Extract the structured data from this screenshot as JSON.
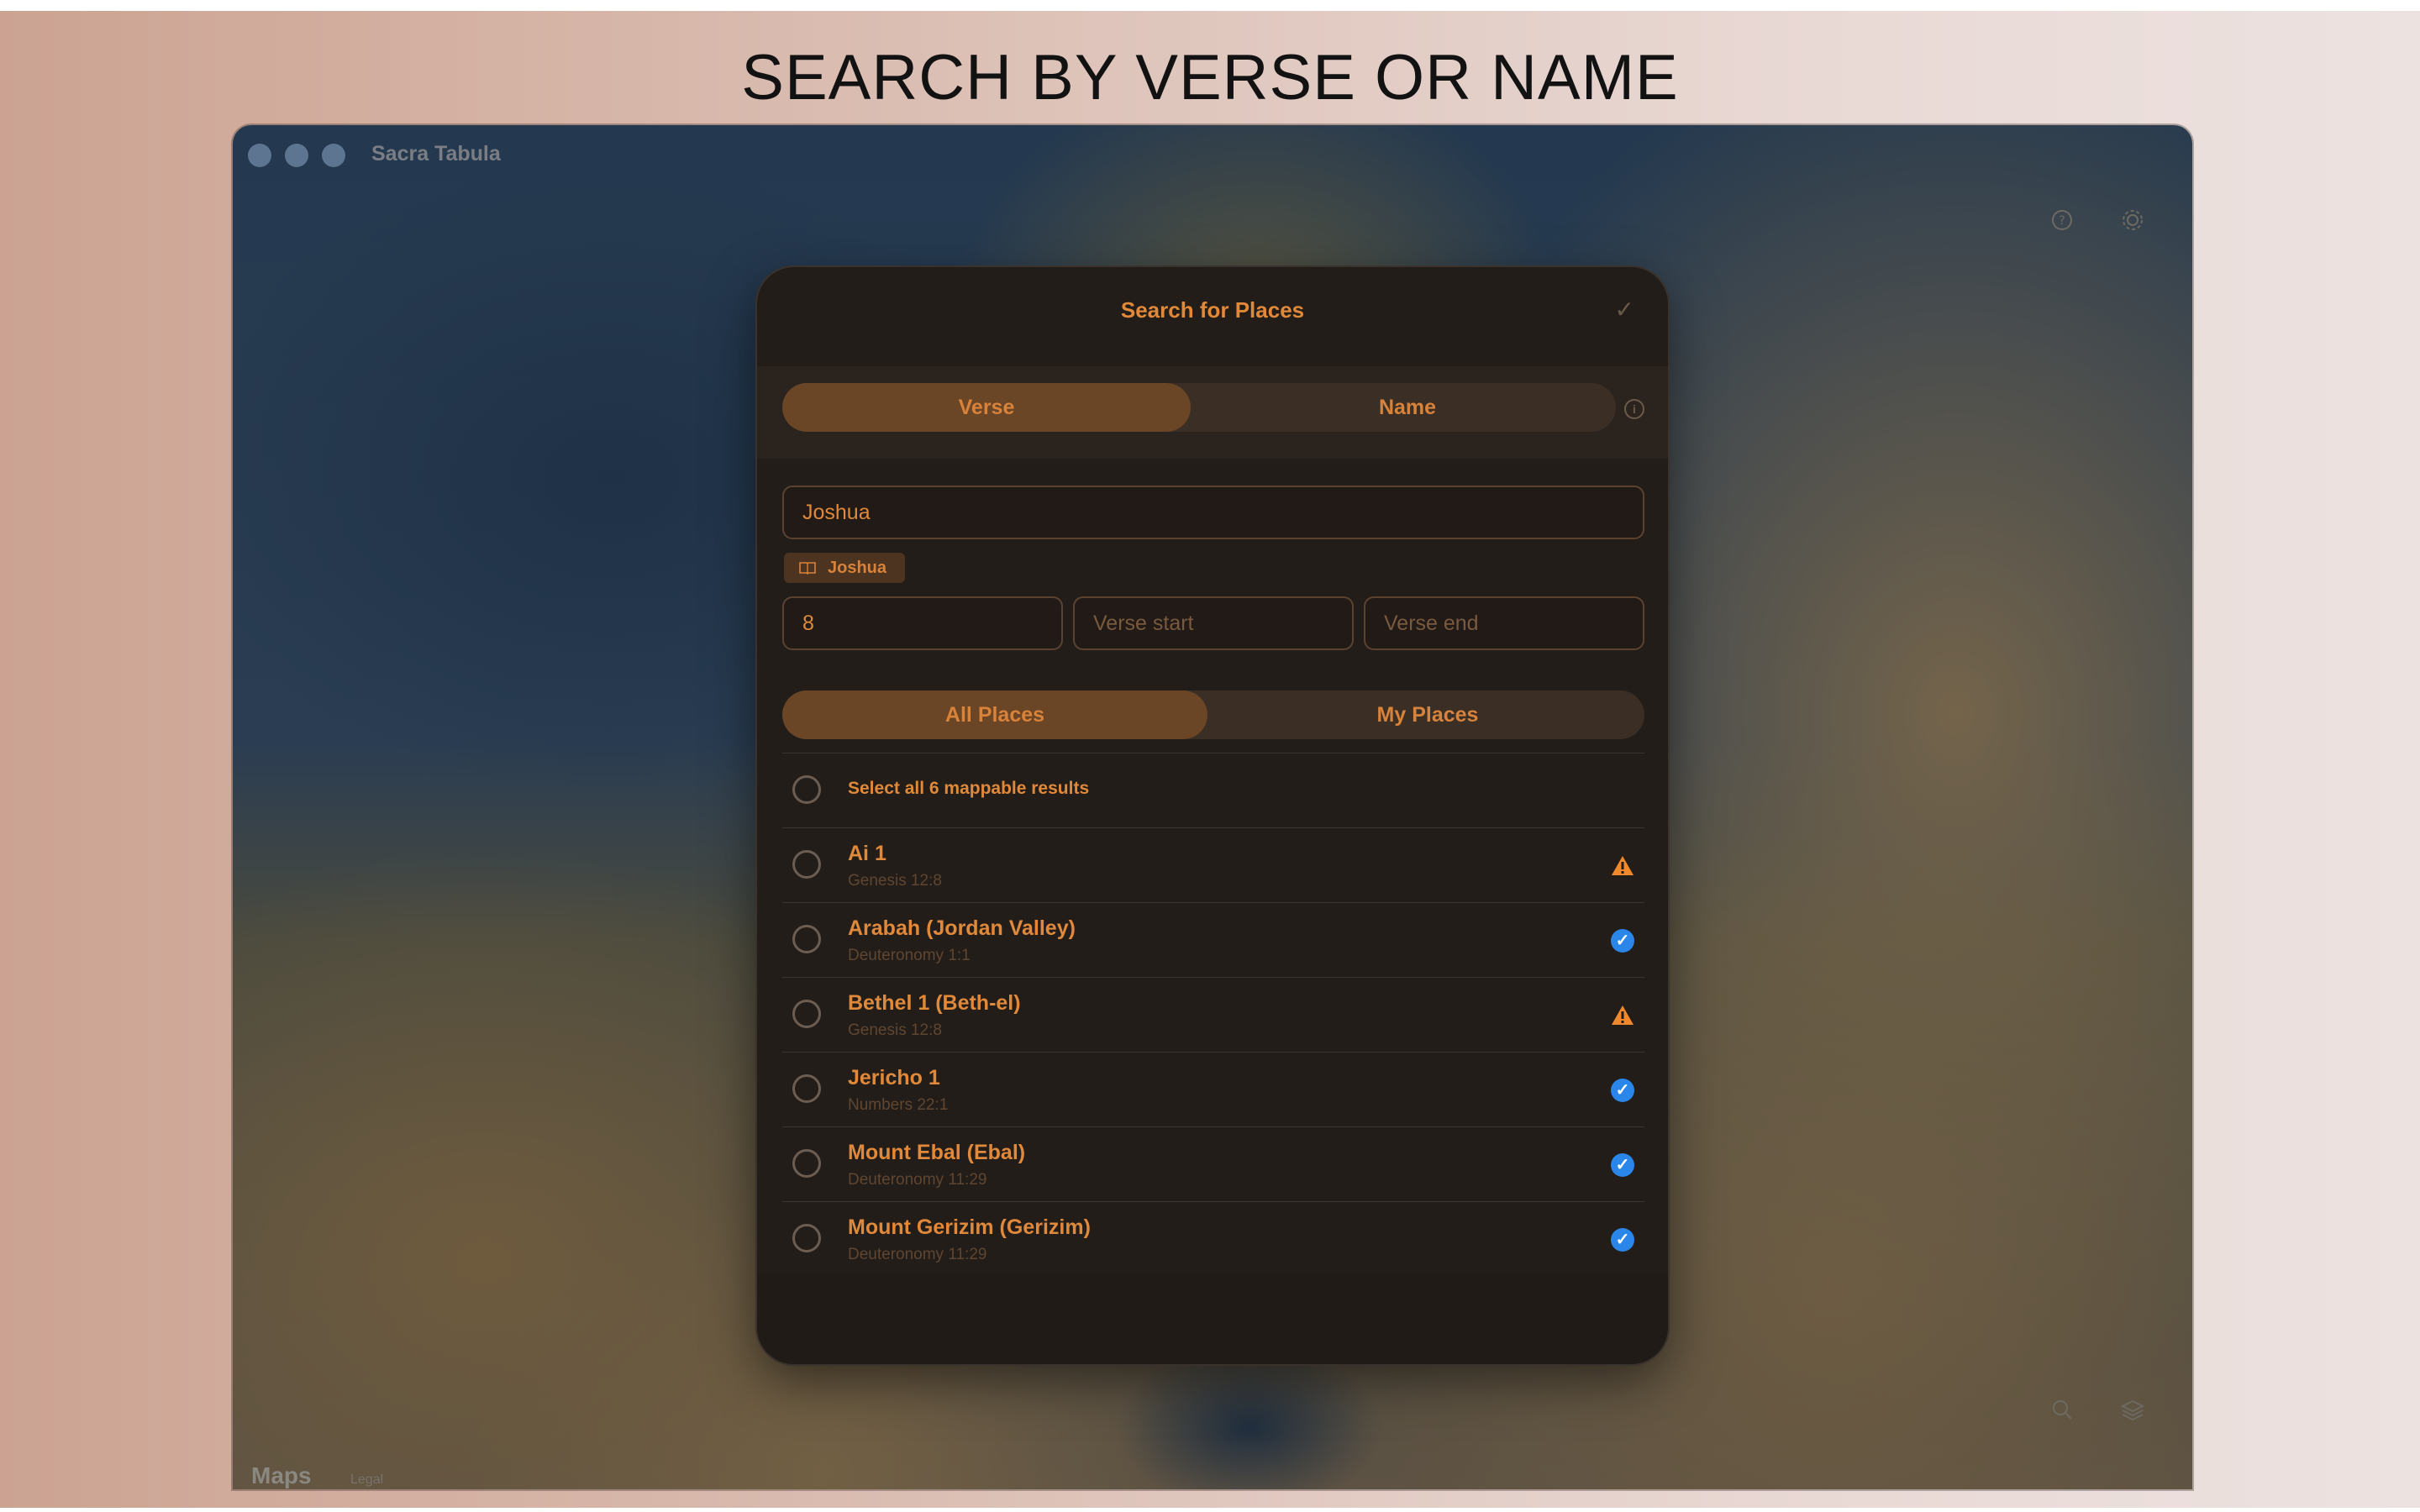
{
  "headline": "SEARCH BY VERSE OR NAME",
  "window": {
    "title": "Sacra Tabula",
    "maps_logo": "Maps",
    "maps_legal": "Legal"
  },
  "icons": {
    "help": "question-circle-icon",
    "settings": "gear-icon",
    "search": "magnifier-icon",
    "layers": "layers-icon"
  },
  "dialog": {
    "title": "Search for Places",
    "done_glyph": "✓",
    "mode_tabs": [
      {
        "label": "Verse",
        "active": true
      },
      {
        "label": "Name",
        "active": false
      }
    ],
    "info_glyph": "i",
    "book_input": {
      "value": "Joshua"
    },
    "book_chip": {
      "label": "Joshua"
    },
    "chapter_input": {
      "value": "8"
    },
    "verse_start": {
      "placeholder": "Verse start"
    },
    "verse_end": {
      "placeholder": "Verse end"
    },
    "scope_tabs": [
      {
        "label": "All Places",
        "active": true
      },
      {
        "label": "My Places",
        "active": false
      }
    ],
    "select_all": "Select all 6 mappable results",
    "results": [
      {
        "name": "Ai 1",
        "ref": "Genesis 12:8",
        "status": "warning"
      },
      {
        "name": "Arabah (Jordan Valley)",
        "ref": "Deuteronomy 1:1",
        "status": "verified"
      },
      {
        "name": "Bethel 1 (Beth-el)",
        "ref": "Genesis 12:8",
        "status": "warning"
      },
      {
        "name": "Jericho 1",
        "ref": "Numbers 22:1",
        "status": "verified"
      },
      {
        "name": "Mount Ebal (Ebal)",
        "ref": "Deuteronomy 11:29",
        "status": "verified"
      },
      {
        "name": "Mount Gerizim (Gerizim)",
        "ref": "Deuteronomy 11:29",
        "status": "verified"
      }
    ]
  },
  "colors": {
    "accent": "#e0893a",
    "verified": "#2a86e8",
    "warning": "#f0882e",
    "dialog_bg": "#231d19"
  }
}
